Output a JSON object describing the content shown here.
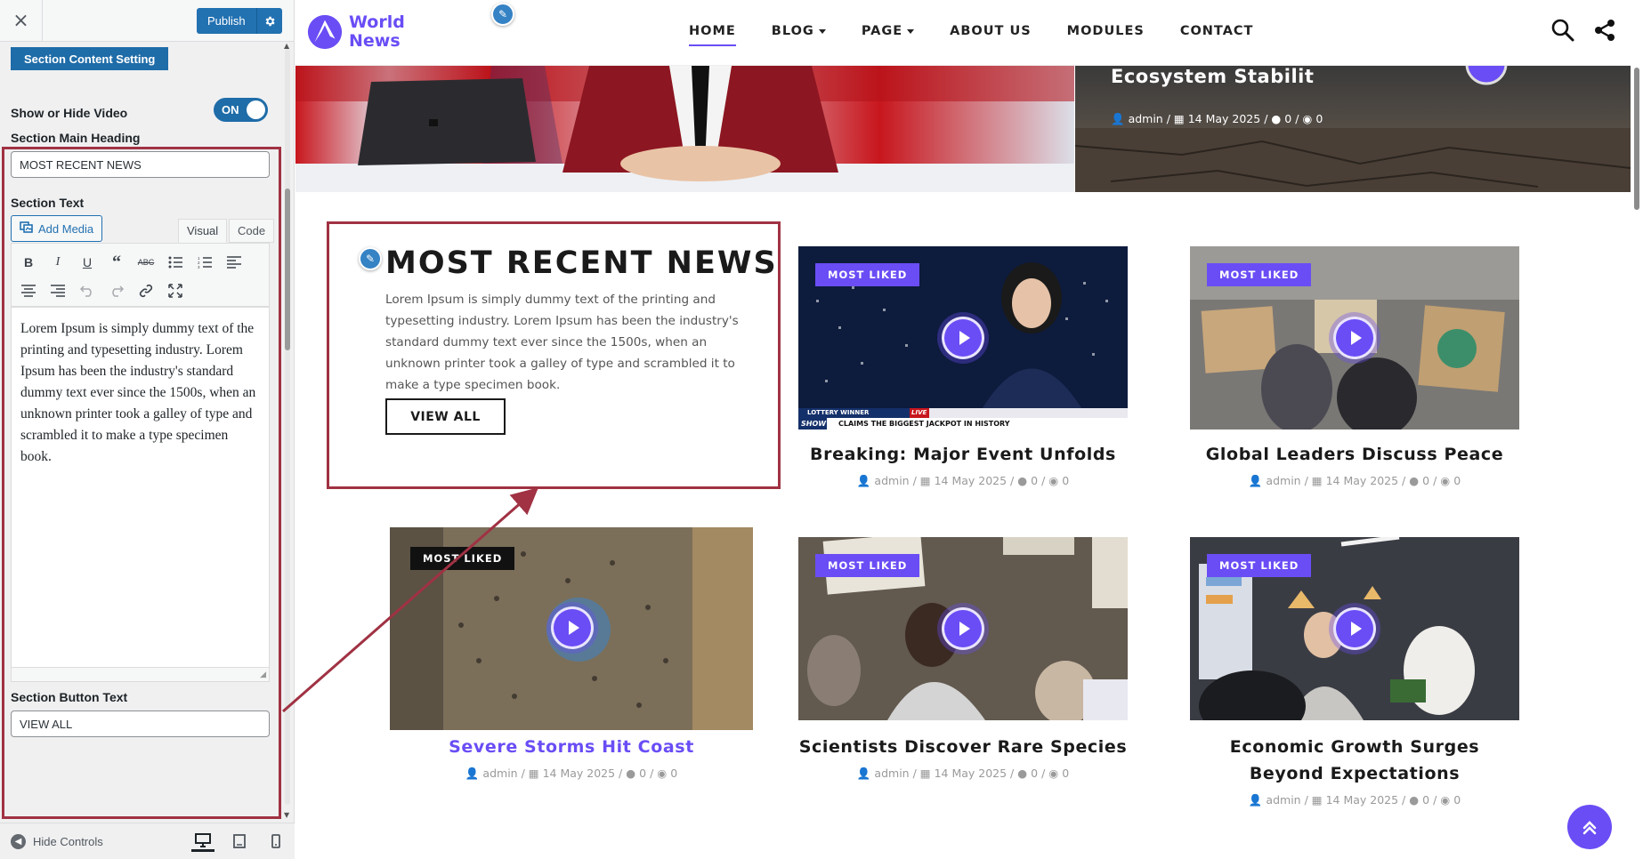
{
  "customizer": {
    "close_label": "×",
    "publish_label": "Publish",
    "section_title": "Section Content Setting",
    "toggle": {
      "label": "Show or Hide Video",
      "state": "ON"
    },
    "main_heading": {
      "label": "Section Main Heading",
      "value": "MOST RECENT NEWS"
    },
    "section_text": {
      "label": "Section Text",
      "add_media": "Add Media",
      "tabs": [
        "Visual",
        "Code"
      ],
      "active_tab": "Visual",
      "content": "Lorem Ipsum is simply dummy text of the printing and typesetting industry. Lorem Ipsum has been the industry's standard dummy text ever since the 1500s, when an unknown printer took a galley of type and scrambled it to make a type specimen book."
    },
    "button_text": {
      "label": "Section Button Text",
      "value": "VIEW ALL"
    },
    "footer": {
      "hide_controls": "Hide Controls",
      "devices": [
        "desktop",
        "tablet",
        "mobile"
      ],
      "active_device": "desktop"
    }
  },
  "site": {
    "logo": {
      "line1": "World",
      "line2": "News"
    },
    "nav": [
      {
        "label": "HOME",
        "active": true,
        "dropdown": false
      },
      {
        "label": "BLOG",
        "active": false,
        "dropdown": true
      },
      {
        "label": "PAGE",
        "active": false,
        "dropdown": true
      },
      {
        "label": "ABOUT US",
        "active": false,
        "dropdown": false
      },
      {
        "label": "MODULES",
        "active": false,
        "dropdown": false
      },
      {
        "label": "CONTACT",
        "active": false,
        "dropdown": false
      }
    ],
    "hero_right": {
      "title": "Ecosystem Stabilit",
      "meta": {
        "author": "admin",
        "date": "14 May 2025",
        "comments": "0",
        "views": "0"
      }
    },
    "intro": {
      "heading": "MOST RECENT NEWS",
      "text": "Lorem Ipsum is simply dummy text of the printing and typesetting industry. Lorem Ipsum has been the industry's standard dummy text ever since the 1500s, when an unknown printer took a galley of type and scrambled it to make a type specimen book.",
      "button": "VIEW ALL"
    },
    "cards": [
      {
        "badge": "MOST LIKED",
        "title": "Breaking: Major Event Unfolds",
        "author": "admin",
        "date": "14 May 2025",
        "comments": "0",
        "views": "0",
        "ticker_top": "LOTTERY WINNER",
        "ticker_live": "LIVE",
        "ticker_show": "SHOW",
        "ticker_text": "CLAIMS THE BIGGEST JACKPOT IN HISTORY"
      },
      {
        "badge": "MOST LIKED",
        "title": "Global Leaders Discuss Peace",
        "author": "admin",
        "date": "14 May 2025",
        "comments": "0",
        "views": "0"
      },
      {
        "badge": "MOST LIKED",
        "title": "Severe Storms Hit Coast",
        "author": "admin",
        "date": "14 May 2025",
        "comments": "0",
        "views": "0"
      },
      {
        "badge": "MOST LIKED",
        "title": "Scientists Discover Rare Species",
        "author": "admin",
        "date": "14 May 2025",
        "comments": "0",
        "views": "0"
      },
      {
        "badge": "MOST LIKED",
        "title": "Economic Growth Surges Beyond Expectations",
        "author": "admin",
        "date": "14 May 2025",
        "comments": "0",
        "views": "0"
      }
    ]
  },
  "colors": {
    "accent": "#6a4df5",
    "wp_blue": "#2271b1",
    "highlight": "#a03243"
  }
}
